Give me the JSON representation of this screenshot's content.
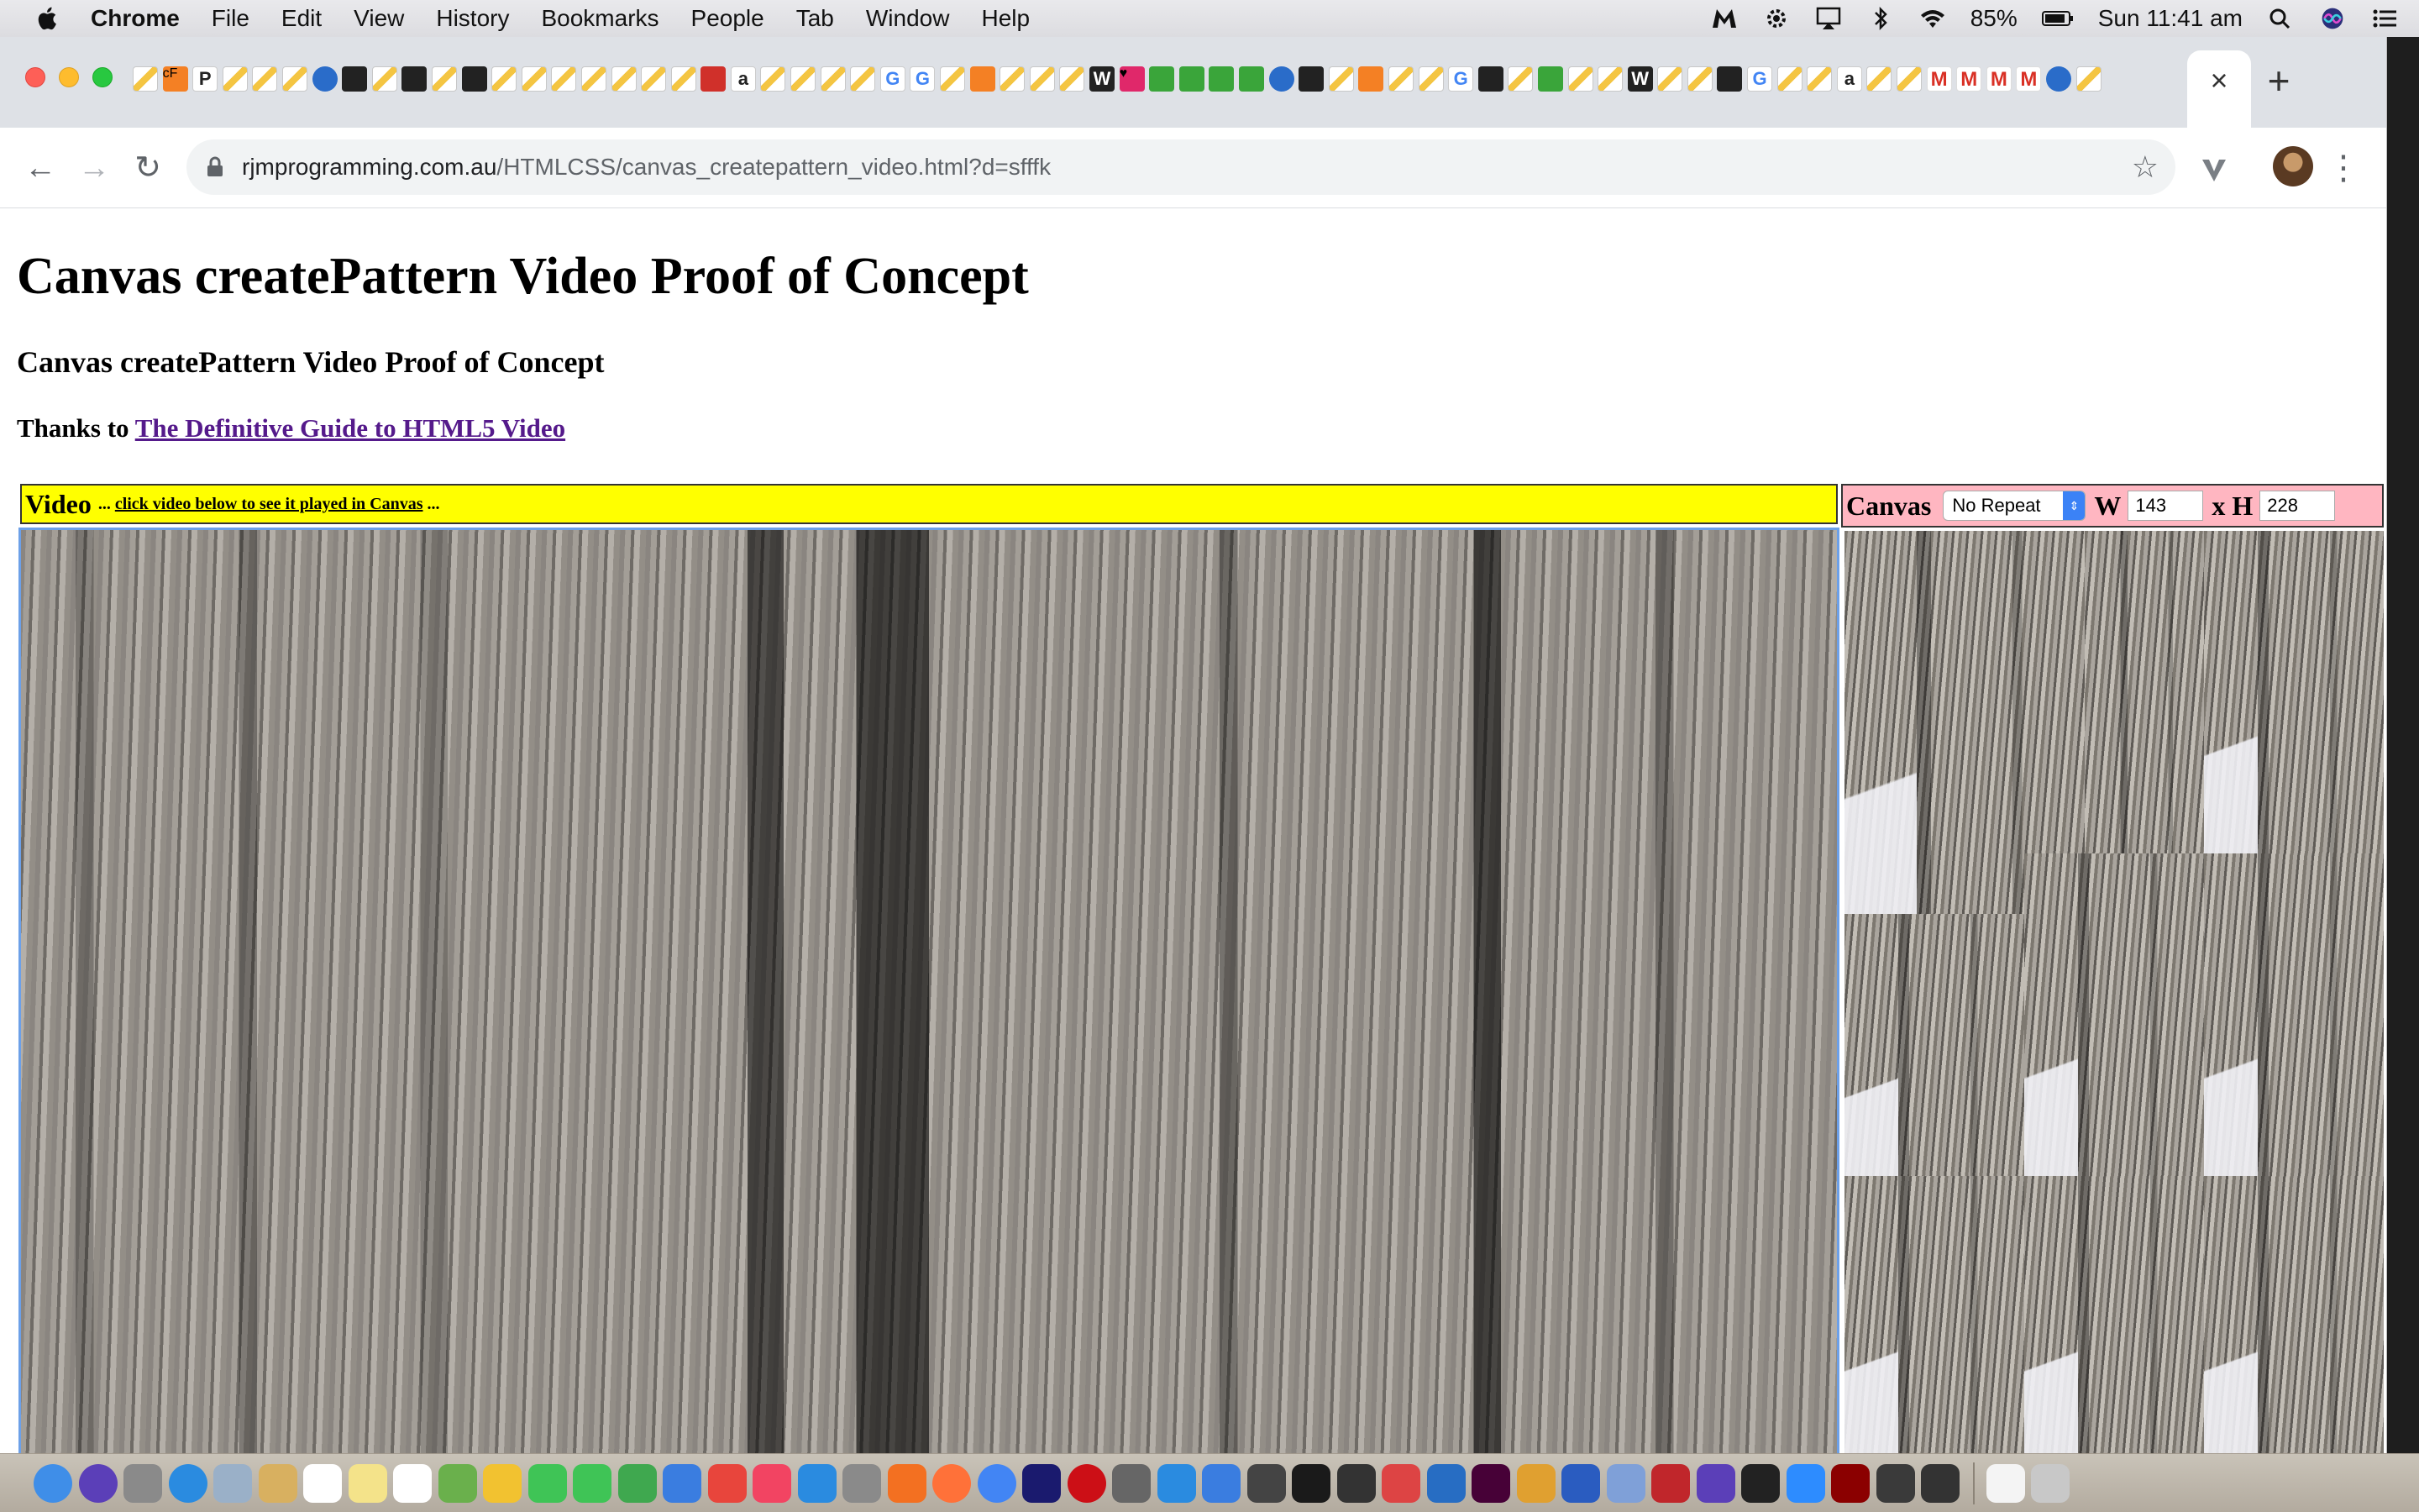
{
  "menubar": {
    "app_name": "Chrome",
    "items": [
      "File",
      "Edit",
      "View",
      "History",
      "Bookmarks",
      "People",
      "Tab",
      "Window",
      "Help"
    ],
    "battery": "85%",
    "clock": "Sun 11:41 am"
  },
  "browser": {
    "url_host": "rjmprogramming.com.au",
    "url_path": "/HTMLCSS/canvas_createpattern_video.html?d=sfffk",
    "tab_close": "×",
    "new_tab": "+",
    "back": "←",
    "forward": "→",
    "reload": "↻",
    "bookmark_star": "☆",
    "menu": "⋮"
  },
  "page": {
    "heading1": "Canvas createPattern Video Proof of Concept",
    "heading3": "Canvas createPattern Video Proof of Concept",
    "thanks_prefix": "Thanks to ",
    "thanks_link": "The Definitive Guide to HTML5 Video",
    "video_label": "Video",
    "video_hint_prefix": " ... ",
    "video_hint_link": "click video below to see it played in Canvas",
    "video_hint_suffix": " ...",
    "canvas_label": "Canvas",
    "repeat_select": {
      "selected": "No Repeat"
    },
    "width_label": "W",
    "width_value": "143",
    "height_label": "x H",
    "height_value": "228"
  },
  "colors": {
    "video_bar": "#ffff00",
    "canvas_bar": "#ffb6c1",
    "link_visited": "#551a8b",
    "video_border": "#6ca0e8"
  },
  "icons": {
    "tab_favicons": [
      "bookmark",
      "cf",
      "pwc",
      "bookmark",
      "bookmark",
      "bookmark",
      "edge",
      "chess",
      "bookmark",
      "dark",
      "bookmark",
      "dark",
      "bookmark",
      "bookmark",
      "bookmark",
      "bookmark",
      "bookmark",
      "bookmark",
      "bookmark",
      "magento",
      "amazon",
      "bookmark",
      "bookmark",
      "bookmark",
      "bookmark",
      "google",
      "google",
      "bookmark",
      "stackoverflow",
      "bookmark",
      "bookmark",
      "bookmark",
      "w",
      "heart",
      "green",
      "green",
      "green",
      "green",
      "blue",
      "dark",
      "bookmark",
      "stackoverflow",
      "bookmark",
      "bookmark",
      "google",
      "dark",
      "bookmark",
      "green",
      "bookmark",
      "bookmark",
      "w",
      "bookmark",
      "bookmark",
      "dark",
      "google",
      "bookmark",
      "bookmark",
      "amazon",
      "bookmark",
      "bookmark",
      "gmail",
      "gmail",
      "gmail",
      "gmail",
      "blue",
      "bookmark"
    ],
    "dock": [
      "finder",
      "siri",
      "launchpad",
      "safari",
      "mail",
      "notes",
      "calendar",
      "notes",
      "reminders",
      "maps",
      "photos",
      "messages",
      "facetime",
      "numbers",
      "keynote",
      "news",
      "music",
      "appstore",
      "preferences",
      "app",
      "firefox",
      "chrome",
      "phpstorm",
      "opera",
      "elephant",
      "app",
      "app",
      "app",
      "terminal",
      "inkscape",
      "app",
      "r",
      "xd",
      "app",
      "app",
      "app",
      "filezilla",
      "headphones",
      "app",
      "zoom",
      "flash",
      "app",
      "app",
      "documents",
      "trash"
    ]
  }
}
